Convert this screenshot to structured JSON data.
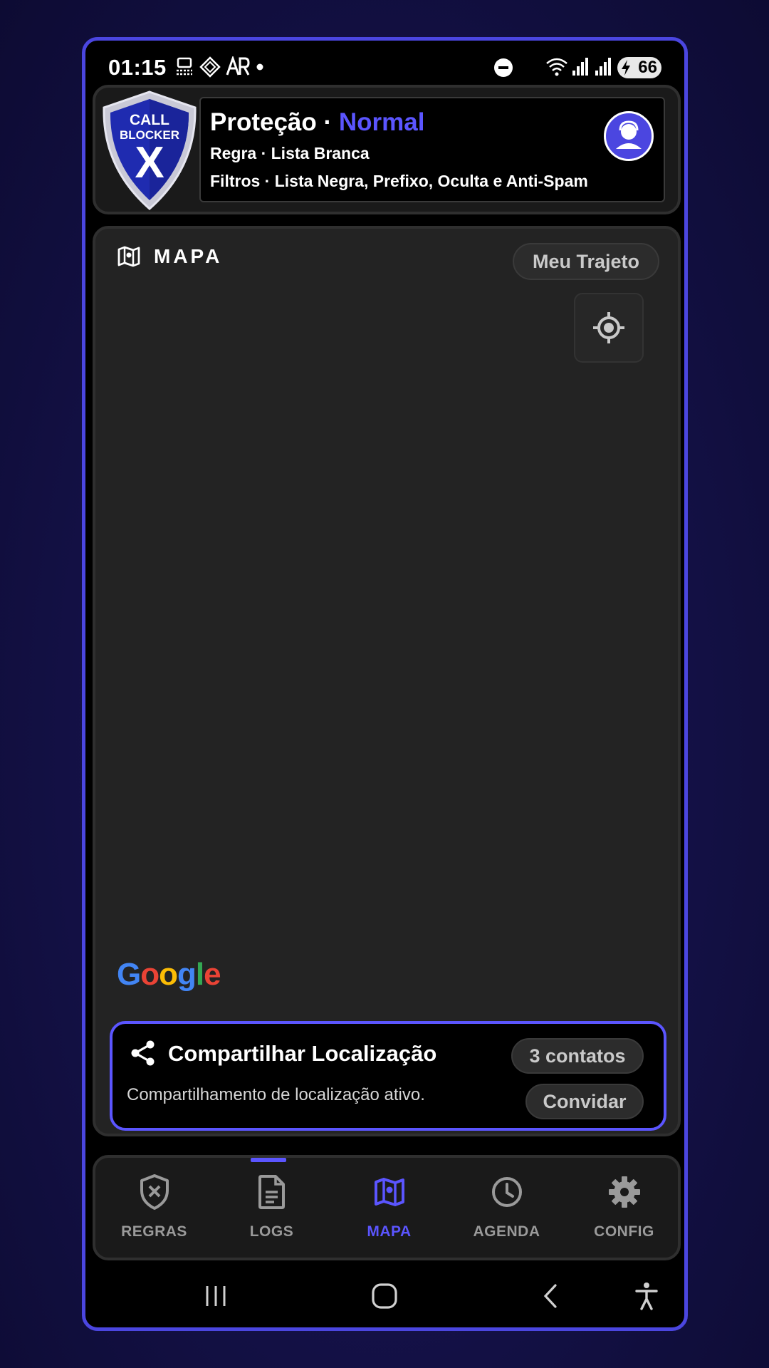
{
  "status_bar": {
    "time": "01:15",
    "battery": "66"
  },
  "header": {
    "logo_line1": "CALL",
    "logo_line2": "BLOCKER",
    "logo_mark": "X",
    "title_prefix": "Proteção · ",
    "title_mode": "Normal",
    "rule_line": "Regra · Lista Branca",
    "filters_line": "Filtros · Lista Negra, Prefixo, Oculta e Anti-Spam",
    "accent_color": "#5b55ff"
  },
  "map": {
    "title": "MAPA",
    "route_button": "Meu Trajeto",
    "attribution": "Google"
  },
  "share": {
    "title": "Compartilhar Localização",
    "description": "Compartilhamento de localização ativo.",
    "contacts_label": "3 contatos",
    "invite_label": "Convidar"
  },
  "nav": {
    "items": [
      {
        "label": "REGRAS",
        "icon": "shield-x-icon"
      },
      {
        "label": "LOGS",
        "icon": "document-icon"
      },
      {
        "label": "MAPA",
        "icon": "map-icon"
      },
      {
        "label": "AGENDA",
        "icon": "clock-icon"
      },
      {
        "label": "CONFIG",
        "icon": "gear-icon"
      }
    ],
    "active": "MAPA"
  }
}
